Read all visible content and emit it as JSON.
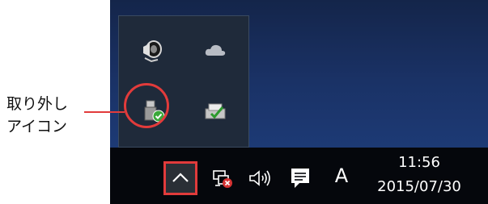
{
  "annotation": {
    "label_line1": "取り外し",
    "label_line2": "アイコン",
    "highlight_color": "#e23b3b"
  },
  "overflow_flyout": {
    "icons": [
      {
        "name": "speaker-sound-icon"
      },
      {
        "name": "onedrive-cloud-icon"
      },
      {
        "name": "safely-remove-hardware-icon"
      },
      {
        "name": "printer-check-icon"
      }
    ]
  },
  "taskbar": {
    "chevron_icon": "chevron-up-icon",
    "network_icon": "network-disconnected-icon",
    "volume_icon": "volume-icon",
    "action_center_icon": "action-center-icon",
    "ime_label": "A",
    "time": "11:56",
    "date": "2015/07/30"
  }
}
